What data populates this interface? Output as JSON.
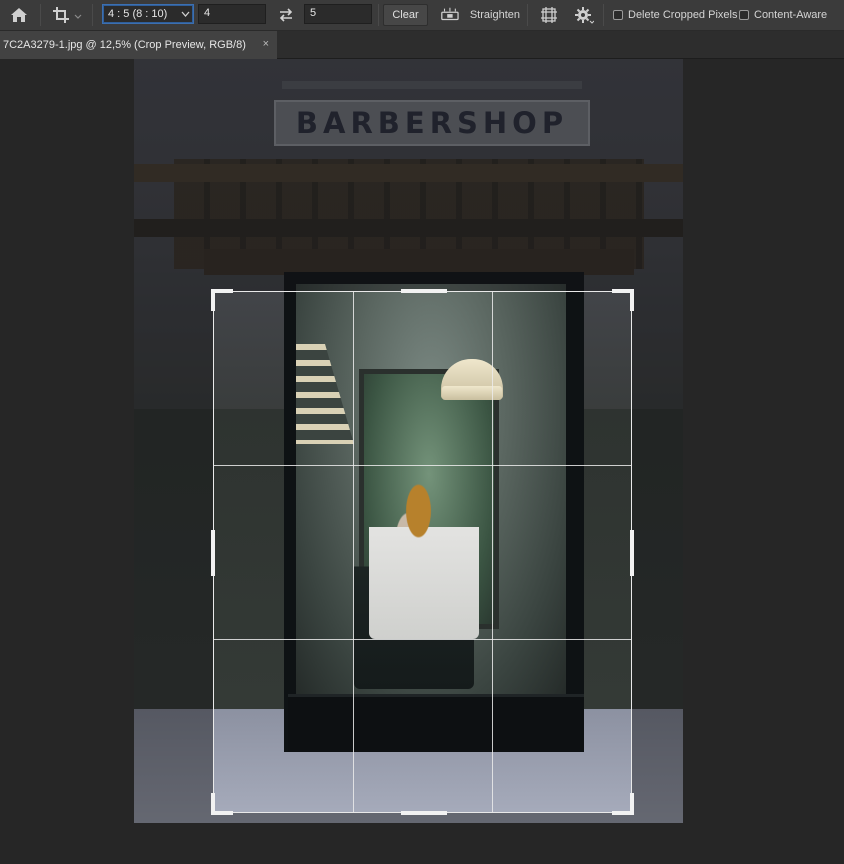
{
  "toolbar": {
    "home_icon": "home-icon",
    "crop_tool_icon": "crop-icon",
    "ratio_select_value": "4 : 5 (8 : 10)",
    "width_value": "4",
    "height_value": "5",
    "swap_icon": "swap-arrows-icon",
    "clear_label": "Clear",
    "straighten_label": "Straighten",
    "overlay_icon": "grid-overlay-icon",
    "settings_icon": "gear-icon",
    "delete_cropped_label": "Delete Cropped Pixels",
    "delete_cropped_checked": false,
    "content_aware_label": "Content-Aware",
    "content_aware_checked": false
  },
  "document_tab": {
    "title": "7C2A3279-1.jpg @ 12,5% (Crop Preview, RGB/8)",
    "close_label": "×"
  },
  "photo": {
    "sign_text": "BARBERSHOP"
  }
}
